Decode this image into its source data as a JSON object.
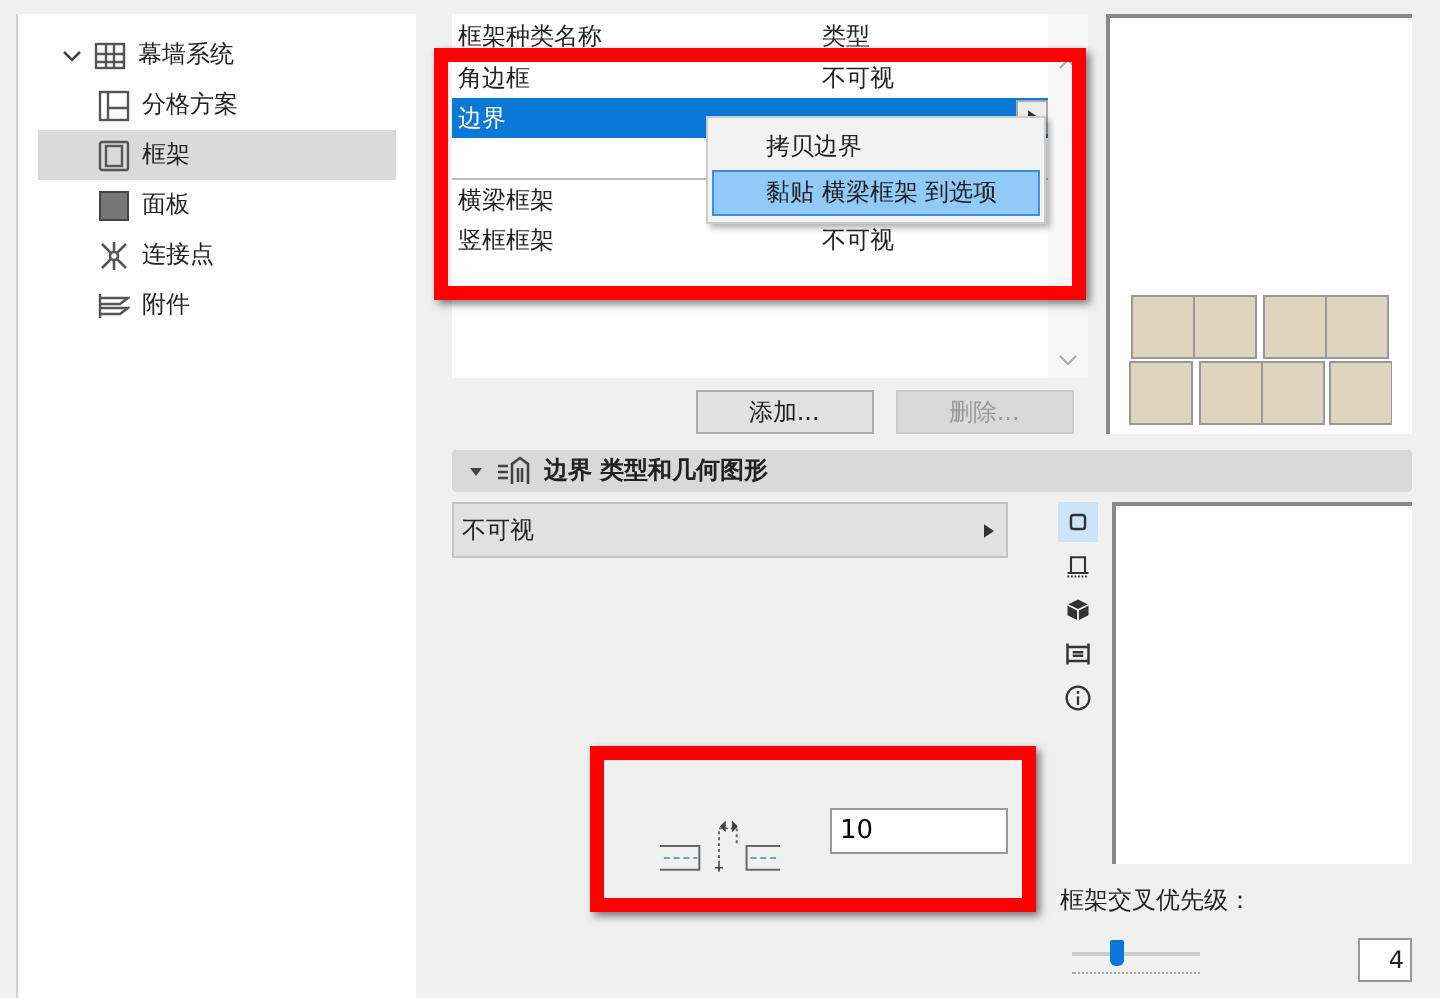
{
  "sidebar": {
    "items": [
      {
        "label": "幕墙系统",
        "expanded": true,
        "selected": false,
        "children": [
          {
            "label": "分格方案",
            "selected": false
          },
          {
            "label": "框架",
            "selected": true
          },
          {
            "label": "面板",
            "selected": false
          },
          {
            "label": "连接点",
            "selected": false
          },
          {
            "label": "附件",
            "selected": false
          }
        ]
      }
    ]
  },
  "frame_list": {
    "columns": [
      "框架种类名称",
      "类型"
    ],
    "rows": [
      {
        "kind": "item",
        "name": "角边框",
        "type": "不可视",
        "selected": false
      },
      {
        "kind": "item",
        "name": "边界",
        "selected": true
      },
      {
        "kind": "separator"
      },
      {
        "kind": "item",
        "name": "横梁框架",
        "selected": false
      },
      {
        "kind": "item",
        "name": "竖框框架",
        "type": "不可视",
        "selected": false
      }
    ]
  },
  "context_menu": {
    "items": [
      {
        "label": "拷贝边界",
        "selected": false
      },
      {
        "label": "黏贴 横梁框架 到选项",
        "selected": true
      }
    ]
  },
  "buttons": [
    {
      "label": "添加...",
      "disabled": false
    },
    {
      "label": "删除...",
      "disabled": true
    }
  ],
  "section": {
    "title": "边界 类型和几何图形",
    "expanded": true
  },
  "type_dropdown": {
    "value": "不可视"
  },
  "view_icons": [
    {
      "selected": true
    },
    {
      "selected": false
    },
    {
      "selected": false
    },
    {
      "selected": false
    },
    {
      "selected": false
    }
  ],
  "offset_field": {
    "value": "10"
  },
  "priority": {
    "label": "框架交叉优先级：",
    "level": 0.35,
    "value": "4"
  }
}
